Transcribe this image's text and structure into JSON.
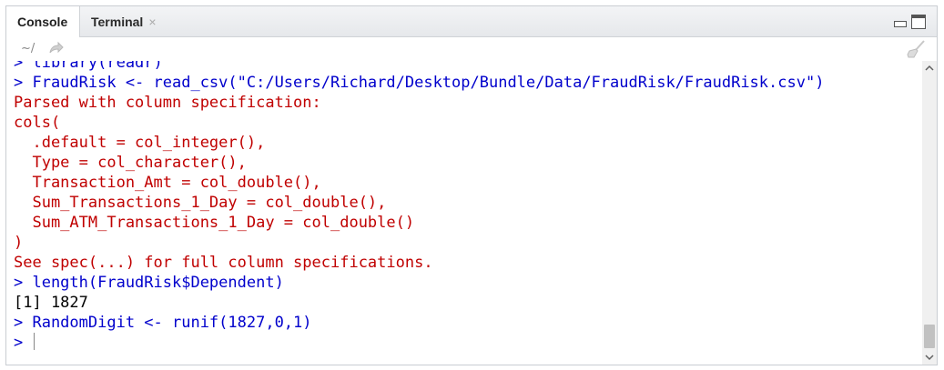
{
  "tabs": [
    {
      "label": "Console",
      "active": true
    },
    {
      "label": "Terminal",
      "close": "×"
    }
  ],
  "path": "~/",
  "console": {
    "lines": [
      {
        "type": "cmd",
        "text": "> library(readr)"
      },
      {
        "type": "cmd",
        "text": "> FraudRisk <- read_csv(\"C:/Users/Richard/Desktop/Bundle/Data/FraudRisk/FraudRisk.csv\")"
      },
      {
        "type": "msg",
        "text": "Parsed with column specification:"
      },
      {
        "type": "msg",
        "text": "cols("
      },
      {
        "type": "msg",
        "text": "  .default = col_integer(),"
      },
      {
        "type": "msg",
        "text": "  Type = col_character(),"
      },
      {
        "type": "msg",
        "text": "  Transaction_Amt = col_double(),"
      },
      {
        "type": "msg",
        "text": "  Sum_Transactions_1_Day = col_double(),"
      },
      {
        "type": "msg",
        "text": "  Sum_ATM_Transactions_1_Day = col_double()"
      },
      {
        "type": "msg",
        "text": ")"
      },
      {
        "type": "msg",
        "text": "See spec(...) for full column specifications."
      },
      {
        "type": "cmd",
        "text": "> length(FraudRisk$Dependent)"
      },
      {
        "type": "out",
        "text": "[1] 1827"
      },
      {
        "type": "cmd",
        "text": "> RandomDigit <- runif(1827,0,1)"
      }
    ],
    "prompt": "> "
  },
  "colors": {
    "command": "#0000cc",
    "message": "#c00000",
    "output": "#000000"
  }
}
